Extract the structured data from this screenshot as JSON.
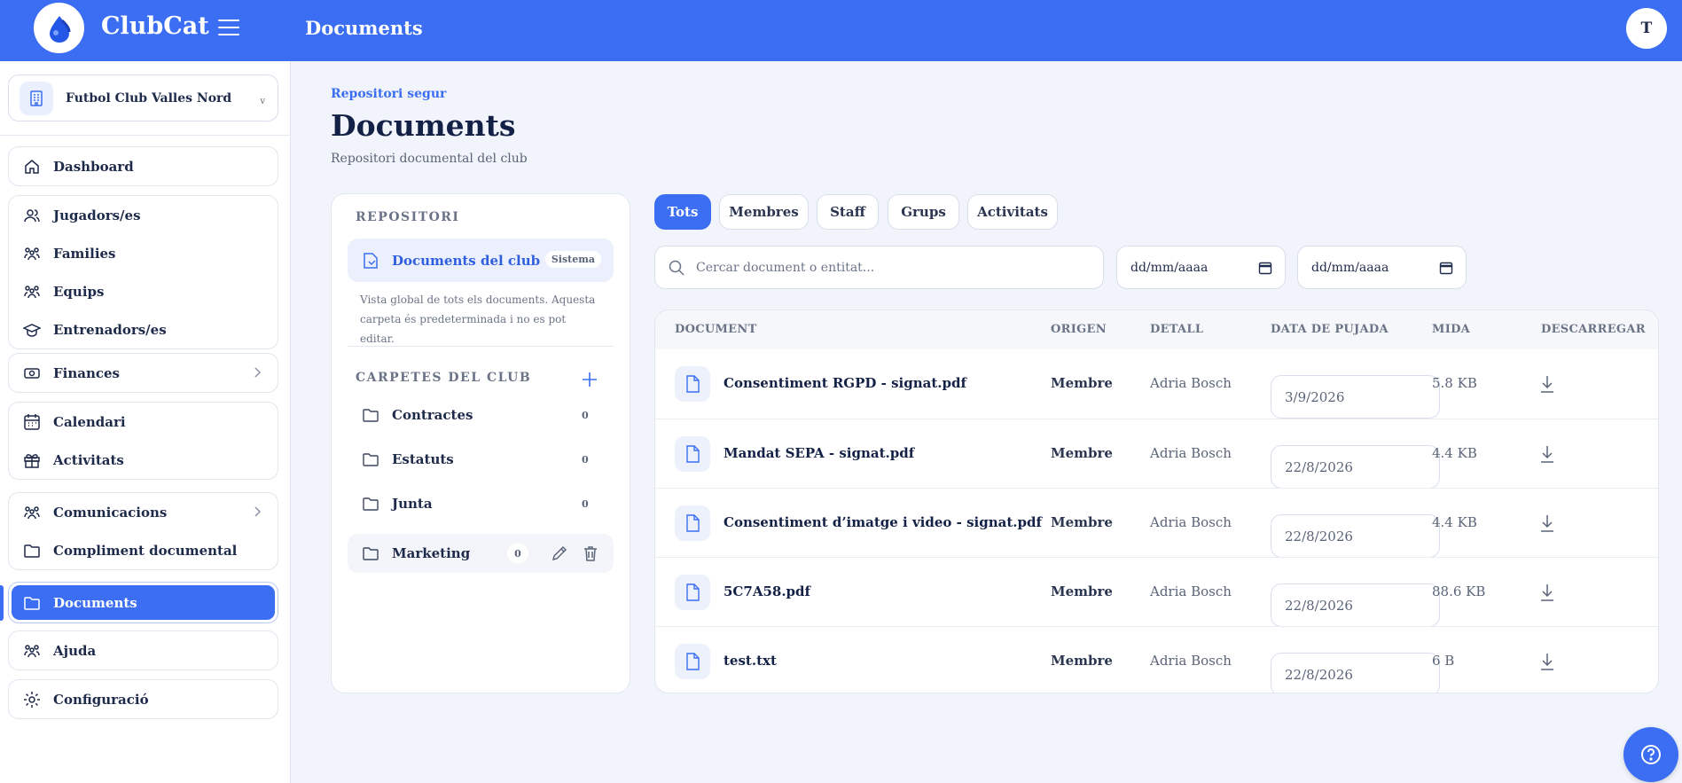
{
  "app": {
    "brand": "ClubCat",
    "section_title": "Documents",
    "user_initial": "T"
  },
  "colors": {
    "accent": "#3b6ef2",
    "background": "#f1f4fb",
    "text": "#1e2a4a"
  },
  "sidebar": {
    "club": {
      "name": "Futbol Club Valles Nord",
      "chevron": "v"
    },
    "items": [
      {
        "label": "Dashboard",
        "icon": "home-icon"
      },
      {
        "label": "Jugadors/es",
        "icon": "users-icon"
      },
      {
        "label": "Families",
        "icon": "family-icon"
      },
      {
        "label": "Equips",
        "icon": "team-icon"
      },
      {
        "label": "Entrenadors/es",
        "icon": "graduation-cap-icon"
      },
      {
        "label": "Finances",
        "icon": "banknote-icon"
      },
      {
        "label": "Calendari",
        "icon": "calendar-icon"
      },
      {
        "label": "Activitats",
        "icon": "gift-icon"
      },
      {
        "label": "Comunicacions",
        "icon": "team-icon"
      },
      {
        "label": "Compliment documental",
        "icon": "folder-icon"
      },
      {
        "label": "Documents",
        "icon": "folder-icon",
        "active": true
      },
      {
        "label": "Ajuda",
        "icon": "team-icon"
      },
      {
        "label": "Configuració",
        "icon": "gear-icon"
      }
    ]
  },
  "header": {
    "eyebrow": "Repositori segur",
    "title": "Documents",
    "subtitle": "Repositori documental del club"
  },
  "repo": {
    "section_title": "REPOSITORI",
    "root": {
      "label": "Documents del club",
      "badge": "Sistema"
    },
    "description": "Vista global de tots els documents. Aquesta carpeta és predeterminada i no es pot editar.",
    "folders_title": "CARPETES DEL CLUB",
    "folders": [
      {
        "name": "Contractes",
        "count": "0"
      },
      {
        "name": "Estatuts",
        "count": "0"
      },
      {
        "name": "Junta",
        "count": "0"
      },
      {
        "name": "Marketing",
        "count": "0"
      }
    ]
  },
  "tabs": [
    {
      "label": "Tots",
      "active": true
    },
    {
      "label": "Membres"
    },
    {
      "label": "Staff"
    },
    {
      "label": "Grups"
    },
    {
      "label": "Activitats"
    }
  ],
  "filters": {
    "search_placeholder": "Cercar document o entitat...",
    "date_from": "dd/mm/aaaa",
    "date_to": "dd/mm/aaaa"
  },
  "table": {
    "columns": [
      "DOCUMENT",
      "ORIGEN",
      "DETALL",
      "DATA DE PUJADA",
      "MIDA",
      "DESCARREGAR"
    ],
    "rows": [
      {
        "document": "Consentiment RGPD - signat.pdf",
        "origen": "Membre",
        "detall": "Adria Bosch",
        "data": "3/9/2026",
        "mida": "5.8 KB"
      },
      {
        "document": "Mandat SEPA - signat.pdf",
        "origen": "Membre",
        "detall": "Adria Bosch",
        "data": "22/8/2026",
        "mida": "4.4 KB"
      },
      {
        "document": "Consentiment d’imatge i video - signat.pdf",
        "origen": "Membre",
        "detall": "Adria Bosch",
        "data": "22/8/2026",
        "mida": "4.4 KB"
      },
      {
        "document": "5C7A58.pdf",
        "origen": "Membre",
        "detall": "Adria Bosch",
        "data": "22/8/2026",
        "mida": "88.6 KB"
      },
      {
        "document": "test.txt",
        "origen": "Membre",
        "detall": "Adria Bosch",
        "data": "22/8/2026",
        "mida": "6 B"
      }
    ]
  }
}
